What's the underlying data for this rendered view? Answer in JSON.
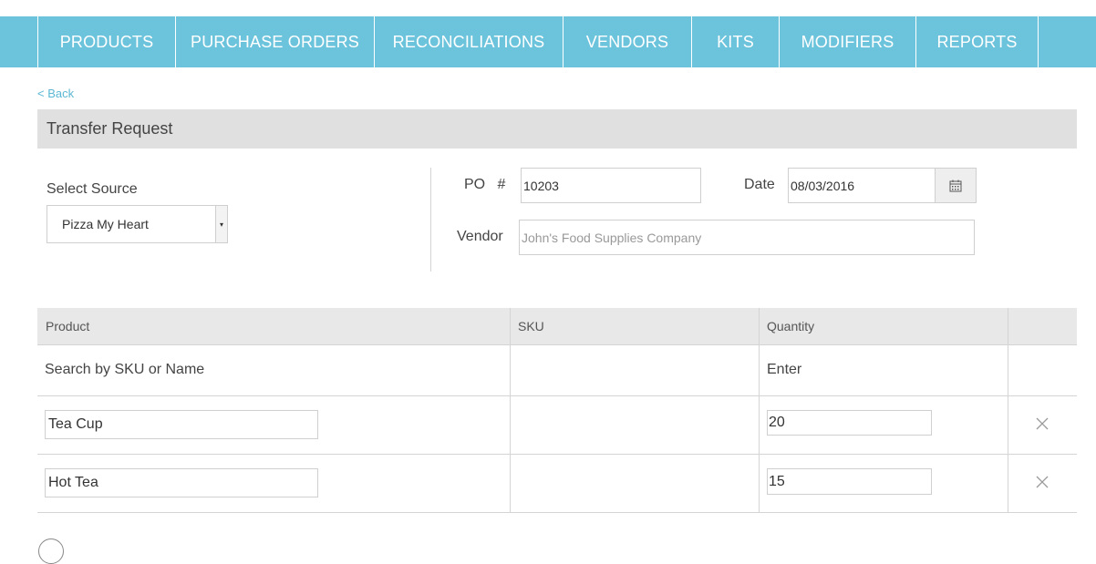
{
  "nav": {
    "items": [
      {
        "label": "PRODUCTS"
      },
      {
        "label": "PURCHASE ORDERS"
      },
      {
        "label": "RECONCILIATIONS"
      },
      {
        "label": "VENDORS"
      },
      {
        "label": "KITS"
      },
      {
        "label": "MODIFIERS"
      },
      {
        "label": "REPORTS"
      }
    ]
  },
  "back_link": "< Back",
  "section_title": "Transfer Request",
  "form": {
    "source_label": "Select Source",
    "source_value": "Pizza My Heart",
    "po_label": "PO   #",
    "po_value": "10203",
    "date_label": "Date",
    "date_value": "08/03/2016",
    "vendor_label": "Vendor",
    "vendor_placeholder": "John's Food Supplies Company"
  },
  "table": {
    "headers": {
      "product": "Product",
      "sku": "SKU",
      "quantity": "Quantity"
    },
    "search_row": {
      "product": "Search by SKU or Name",
      "quantity": "Enter"
    },
    "rows": [
      {
        "product": "Tea Cup",
        "sku": "",
        "quantity": "20"
      },
      {
        "product": "Hot Tea",
        "sku": "",
        "quantity": "15"
      }
    ]
  },
  "colors": {
    "nav_bg": "#6cc3dc",
    "link": "#5bb7d3",
    "header_bg": "#e0e0e0"
  },
  "icons": {
    "calendar": "calendar-icon",
    "remove": "close-icon",
    "dropdown": "chevron-down-icon"
  }
}
